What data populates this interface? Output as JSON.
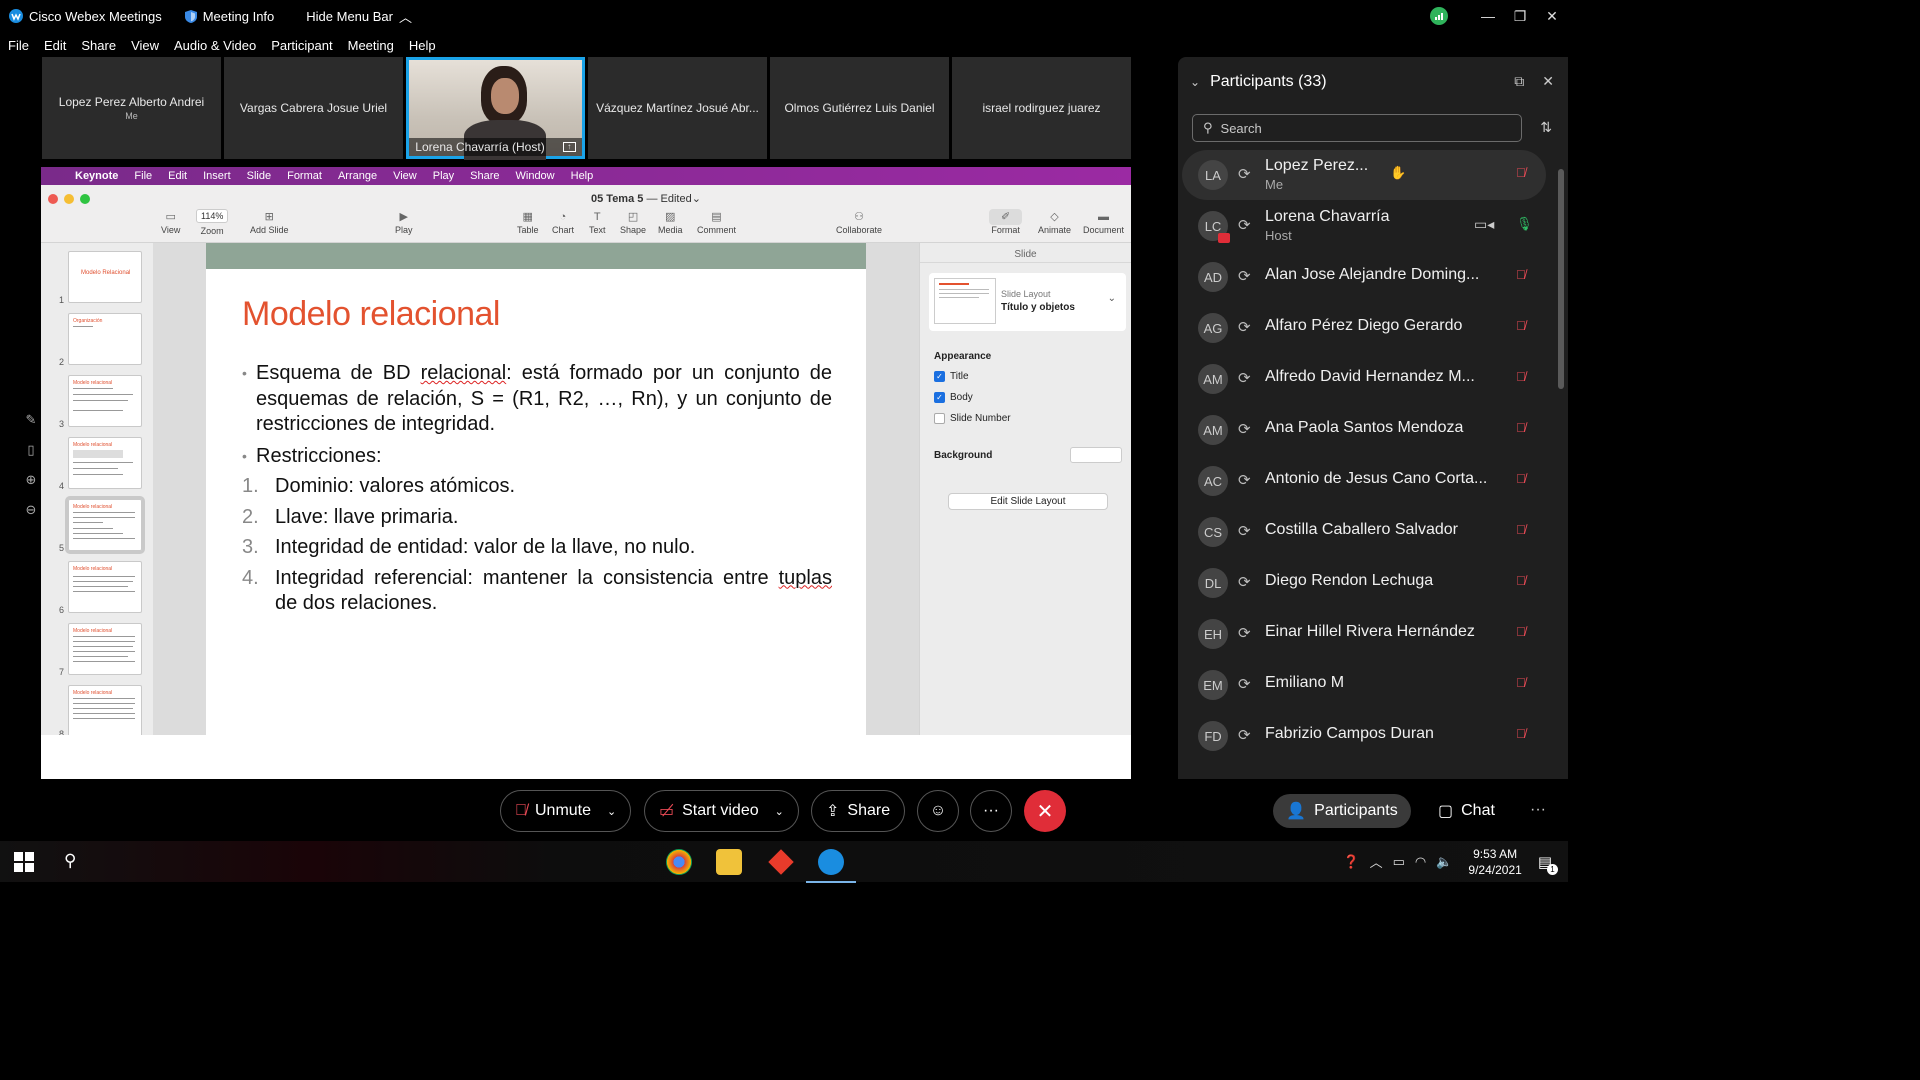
{
  "titlebar": {
    "app_name": "Cisco Webex Meetings",
    "meeting_info": "Meeting Info",
    "hide_menu": "Hide Menu Bar"
  },
  "menu": [
    "File",
    "Edit",
    "Share",
    "View",
    "Audio & Video",
    "Participant",
    "Meeting",
    "Help"
  ],
  "video_strip": [
    {
      "name": "Lopez Perez Alberto Andrei",
      "sub": "Me"
    },
    {
      "name": "Vargas Cabrera Josue Uriel",
      "sub": ""
    },
    {
      "name": "Lorena Chavarría  (Host)",
      "sub": "",
      "active": true
    },
    {
      "name": "Vázquez Martínez Josué Abr...",
      "sub": ""
    },
    {
      "name": "Olmos Gutiérrez Luis Daniel",
      "sub": ""
    },
    {
      "name": "israel rodirguez juarez",
      "sub": ""
    }
  ],
  "keynote": {
    "mac_menu": [
      "Keynote",
      "File",
      "Edit",
      "Insert",
      "Slide",
      "Format",
      "Arrange",
      "View",
      "Play",
      "Share",
      "Window",
      "Help"
    ],
    "doc_title": "05 Tema 5",
    "doc_status": "Edited",
    "zoom": "114%",
    "tools": [
      "View",
      "Zoom",
      "Add Slide",
      "Play",
      "Table",
      "Chart",
      "Text",
      "Shape",
      "Media",
      "Comment",
      "Collaborate",
      "Format",
      "Animate",
      "Document"
    ],
    "slide_numbers": [
      "1",
      "2",
      "3",
      "4",
      "5",
      "6",
      "7",
      "8"
    ],
    "thumb_titles": [
      "Modelo Relacional",
      "Organización",
      "Modelo relacional",
      "Modelo relacional",
      "Modelo relacional",
      "Modelo relacional",
      "Modelo relacional",
      "Modelo relacional"
    ],
    "slide": {
      "title": "Modelo relacional",
      "bullet1_pre": "Esquema de BD ",
      "bullet1_u": "relacional",
      "bullet1_post": ": está formado por un conjunto de esquemas de relación, S = (R1, R2, …, Rn), y un conjunto de restricciones de integridad.",
      "bullet2": "Restricciones:",
      "items": [
        {
          "n": "1.",
          "text": "Dominio: valores atómicos."
        },
        {
          "n": "2.",
          "text": "Llave: llave primaria."
        },
        {
          "n": "3.",
          "text": "Integridad de entidad: valor de la llave, no nulo."
        }
      ],
      "item4_n": "4.",
      "item4_pre": "Integridad referencial: mantener la consistencia entre ",
      "item4_u": "tuplas",
      "item4_post": " de dos relaciones."
    },
    "inspector": {
      "tab": "Slide",
      "layout_label": "Slide Layout",
      "layout_value": "Título y objetos",
      "appearance": "Appearance",
      "title_chk": "Title",
      "body_chk": "Body",
      "slidenum_chk": "Slide Number",
      "background": "Background",
      "edit_layout": "Edit Slide Layout"
    }
  },
  "participants": {
    "header": "Participants (33)",
    "search_placeholder": "Search",
    "list": [
      {
        "initials": "LA",
        "name": "Lopez Perez...",
        "role": "Me",
        "mic": "off",
        "me": true
      },
      {
        "initials": "LC",
        "name": "Lorena Chavarría",
        "role": "Host",
        "mic": "on"
      },
      {
        "initials": "AD",
        "name": "Alan Jose Alejandre Doming...",
        "role": "",
        "mic": "off"
      },
      {
        "initials": "AG",
        "name": "Alfaro Pérez Diego Gerardo",
        "role": "",
        "mic": "off"
      },
      {
        "initials": "AM",
        "name": "Alfredo David Hernandez M...",
        "role": "",
        "mic": "off"
      },
      {
        "initials": "AM",
        "name": "Ana Paola Santos Mendoza",
        "role": "",
        "mic": "off"
      },
      {
        "initials": "AC",
        "name": "Antonio de Jesus Cano Corta...",
        "role": "",
        "mic": "off"
      },
      {
        "initials": "CS",
        "name": "Costilla Caballero Salvador",
        "role": "",
        "mic": "off"
      },
      {
        "initials": "DL",
        "name": "Diego Rendon Lechuga",
        "role": "",
        "mic": "off"
      },
      {
        "initials": "EH",
        "name": "Einar Hillel Rivera Hernández",
        "role": "",
        "mic": "off"
      },
      {
        "initials": "EM",
        "name": "Emiliano M",
        "role": "",
        "mic": "off"
      },
      {
        "initials": "FD",
        "name": "Fabrizio Campos Duran",
        "role": "",
        "mic": "off"
      }
    ]
  },
  "controls": {
    "unmute": "Unmute",
    "start_video": "Start video",
    "share": "Share",
    "participants": "Participants",
    "chat": "Chat"
  },
  "taskbar": {
    "time": "9:53 AM",
    "date": "9/24/2021",
    "notif_count": "1"
  }
}
